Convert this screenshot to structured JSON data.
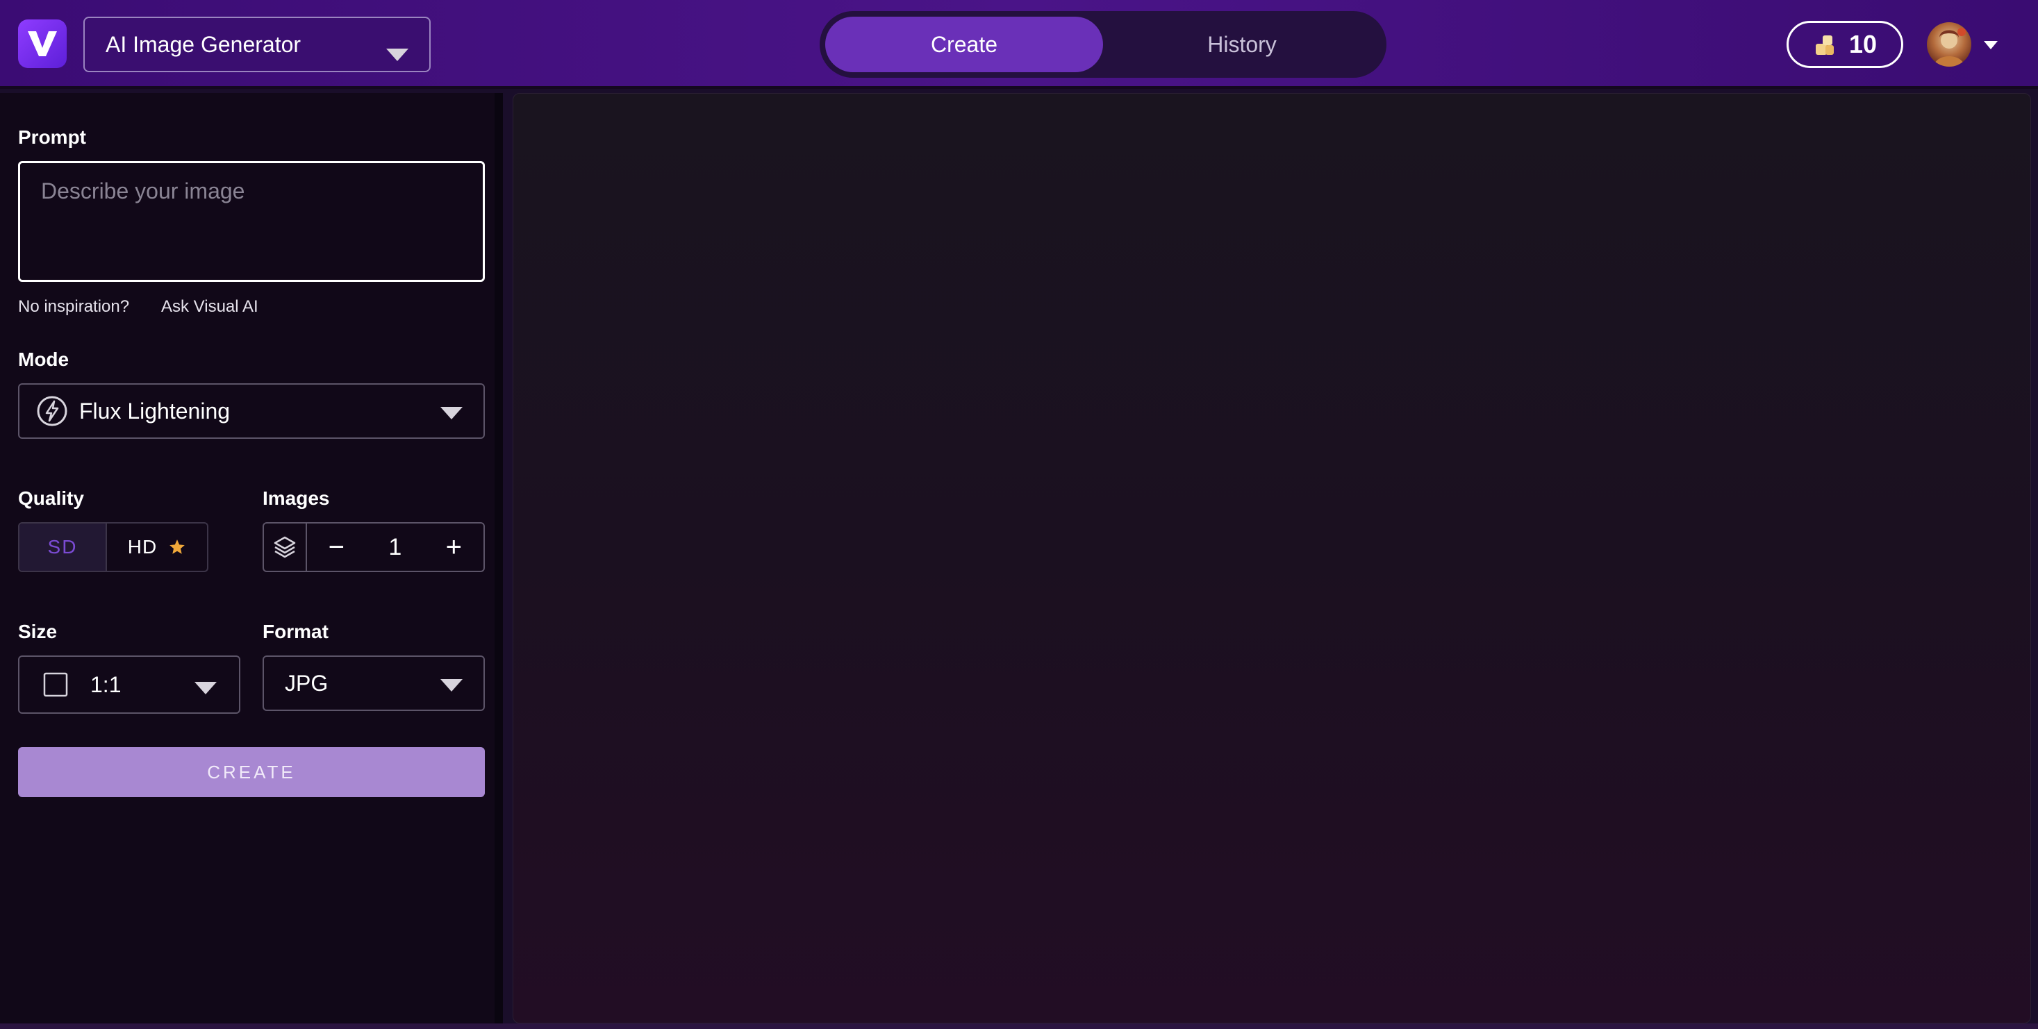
{
  "header": {
    "tool_select": {
      "value": "AI Image Generator"
    },
    "tabs": [
      {
        "label": "Create",
        "active": true
      },
      {
        "label": "History",
        "active": false
      }
    ],
    "credits": {
      "value": "10"
    }
  },
  "panel": {
    "prompt": {
      "label": "Prompt",
      "placeholder": "Describe your image",
      "hint": "No inspiration?",
      "hint_link": "Ask Visual AI"
    },
    "mode": {
      "label": "Mode",
      "value": "Flux Lightening"
    },
    "quality": {
      "label": "Quality",
      "options": [
        "SD",
        "HD"
      ],
      "selected": "SD"
    },
    "images": {
      "label": "Images",
      "count": "1",
      "minus": "−",
      "plus": "+"
    },
    "size": {
      "label": "Size",
      "value": "1:1"
    },
    "format": {
      "label": "Format",
      "value": "JPG"
    },
    "create_label": "CREATE"
  },
  "colors": {
    "accent": "#6a30b8",
    "create_button": "#a888d2",
    "hd_star": "#f0a83a",
    "sd_text": "#7b4bd4"
  },
  "icons": {
    "logo": "brand-v-logo",
    "credits": "coins-icon",
    "mode": "bolt-icon",
    "images": "layers-icon",
    "size": "square-icon",
    "hd": "star-icon"
  }
}
